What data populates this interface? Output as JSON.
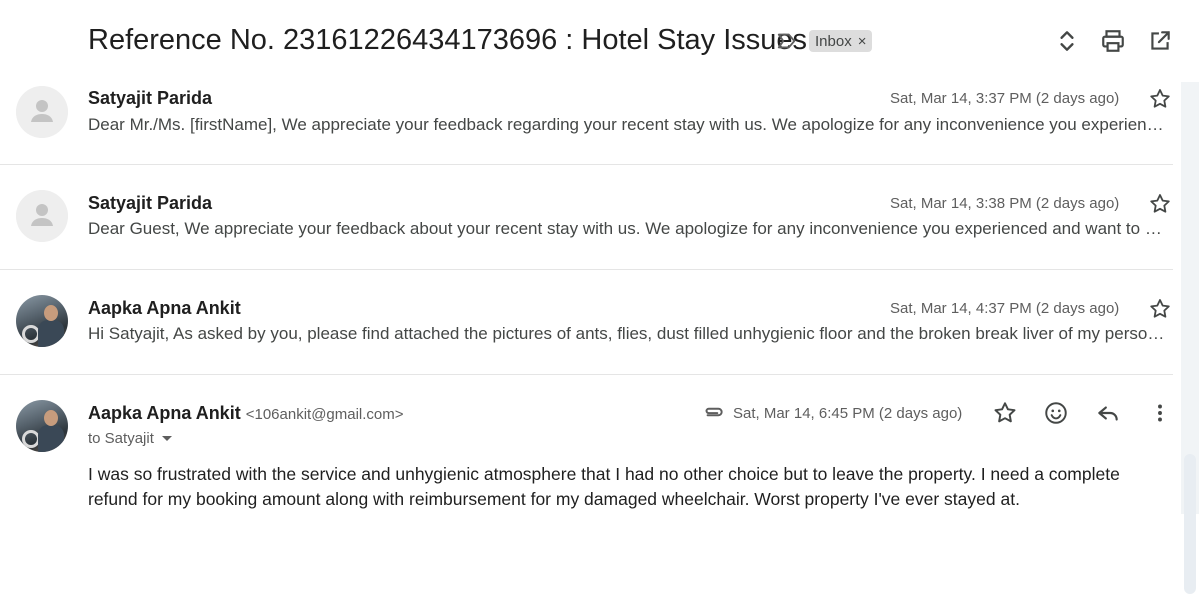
{
  "thread": {
    "subject": "Reference No. 23161226434173696 : Hotel Stay Issues",
    "label": "Inbox",
    "label_remove": "×"
  },
  "messages": [
    {
      "sender": "Satyajit Parida",
      "date": "Sat, Mar 14, 3:37 PM (2 days ago)",
      "snippet": "Dear Mr./Ms. [firstName], We appreciate your feedback regarding your recent stay with us. We apologize for any inconvenience you experienced and want to assure you that"
    },
    {
      "sender": "Satyajit Parida",
      "date": "Sat, Mar 14, 3:38 PM (2 days ago)",
      "snippet": "Dear Guest, We appreciate your feedback about your recent stay with us. We apologize for any inconvenience you experienced and want to assure you that"
    },
    {
      "sender": "Aapka Apna Ankit",
      "date": "Sat, Mar 14, 4:37 PM (2 days ago)",
      "snippet": "Hi Satyajit, As asked by you, please find attached the pictures of ants, flies, dust filled unhygienic floor and the broken break liver of my personal wheelchair"
    }
  ],
  "expanded": {
    "sender": "Aapka Apna Ankit",
    "email": "<106ankit@gmail.com>",
    "date": "Sat, Mar 14, 6:45 PM (2 days ago)",
    "to": "to Satyajit",
    "body": "I was so frustrated with the service and unhygienic atmosphere that I had no other choice but to leave the property. I need a complete refund for my booking amount along with reimbursement for my damaged wheelchair. Worst property I've ever stayed at."
  },
  "icons": {
    "importance": "importance-marker-icon",
    "expand": "expand-all-icon",
    "print": "print-icon",
    "popout": "open-in-new-window-icon",
    "star": "star-icon",
    "avatar": "default-avatar-icon",
    "attachment": "attachment-icon",
    "emoji": "emoji-reaction-icon",
    "reply": "reply-icon",
    "more": "more-vert-icon"
  }
}
